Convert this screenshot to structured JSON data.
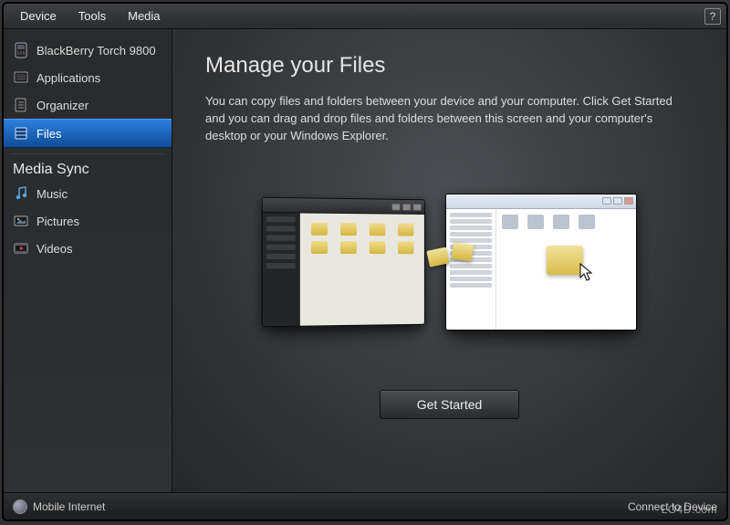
{
  "menubar": {
    "items": [
      "Device",
      "Tools",
      "Media"
    ],
    "help": "?"
  },
  "sidebar": {
    "device": {
      "label": "BlackBerry Torch 9800",
      "icon": "device-icon"
    },
    "nav": [
      {
        "label": "Applications",
        "icon": "applications-icon",
        "selected": false
      },
      {
        "label": "Organizer",
        "icon": "organizer-icon",
        "selected": false
      },
      {
        "label": "Files",
        "icon": "files-icon",
        "selected": true
      }
    ],
    "media_sync_heading": "Media Sync",
    "media": [
      {
        "label": "Music",
        "icon": "music-icon"
      },
      {
        "label": "Pictures",
        "icon": "pictures-icon"
      },
      {
        "label": "Videos",
        "icon": "videos-icon"
      }
    ]
  },
  "content": {
    "title": "Manage your Files",
    "body": "You can copy files and folders between your device and your computer.  Click Get Started and you can drag and drop files and folders between this screen and your computer's desktop or your Windows Explorer.",
    "cta": "Get Started"
  },
  "footer": {
    "left": "Mobile Internet",
    "right": "Connect to Device"
  },
  "watermark": "LO4D.com"
}
